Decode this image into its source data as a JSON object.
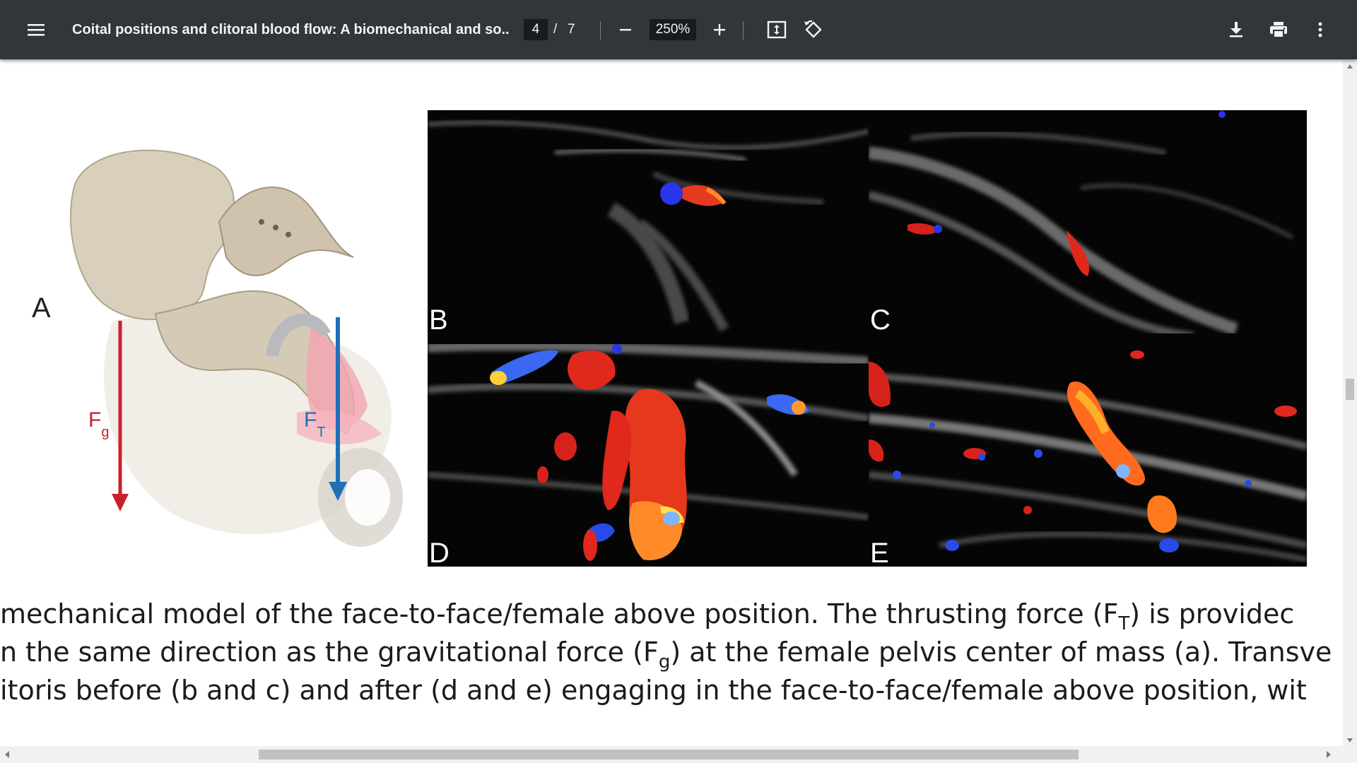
{
  "toolbar": {
    "title": "Coital positions and clitoral blood flow: A biomechanical and so...",
    "page_current": "4",
    "page_separator": "/",
    "page_total": "7",
    "zoom": "250%",
    "icons": {
      "menu": "hamburger-menu-icon",
      "zoom_out": "minus-icon",
      "zoom_in": "plus-icon",
      "fit": "fit-to-page-icon",
      "rotate": "rotate-icon",
      "download": "download-icon",
      "print": "print-icon",
      "more": "more-vertical-icon"
    },
    "colors": {
      "bar": "#323639",
      "field": "#191b1c",
      "text": "#f1f3f4"
    }
  },
  "figure": {
    "panel_a_label": "A",
    "force_gravity": {
      "base": "F",
      "sub": "g",
      "color": "#c8202c"
    },
    "force_thrust": {
      "base": "F",
      "sub": "T",
      "color": "#1f6fb8"
    },
    "ultrasound_panels": [
      {
        "label": "B"
      },
      {
        "label": "C"
      },
      {
        "label": "D"
      },
      {
        "label": "E"
      }
    ]
  },
  "caption": {
    "line1": {
      "pre": "mechanical model of the face-to-face/female above position. The thrusting force (F",
      "sub": "T",
      "post": ") is providec"
    },
    "line2": {
      "pre": "n the same direction as the gravitational force (F",
      "sub": "g",
      "post": ") at the female pelvis center of mass (a). Transve"
    },
    "line3": {
      "text": "itoris before (b and c) and after (d and e) engaging in the face-to-face/female above position, wit"
    }
  }
}
